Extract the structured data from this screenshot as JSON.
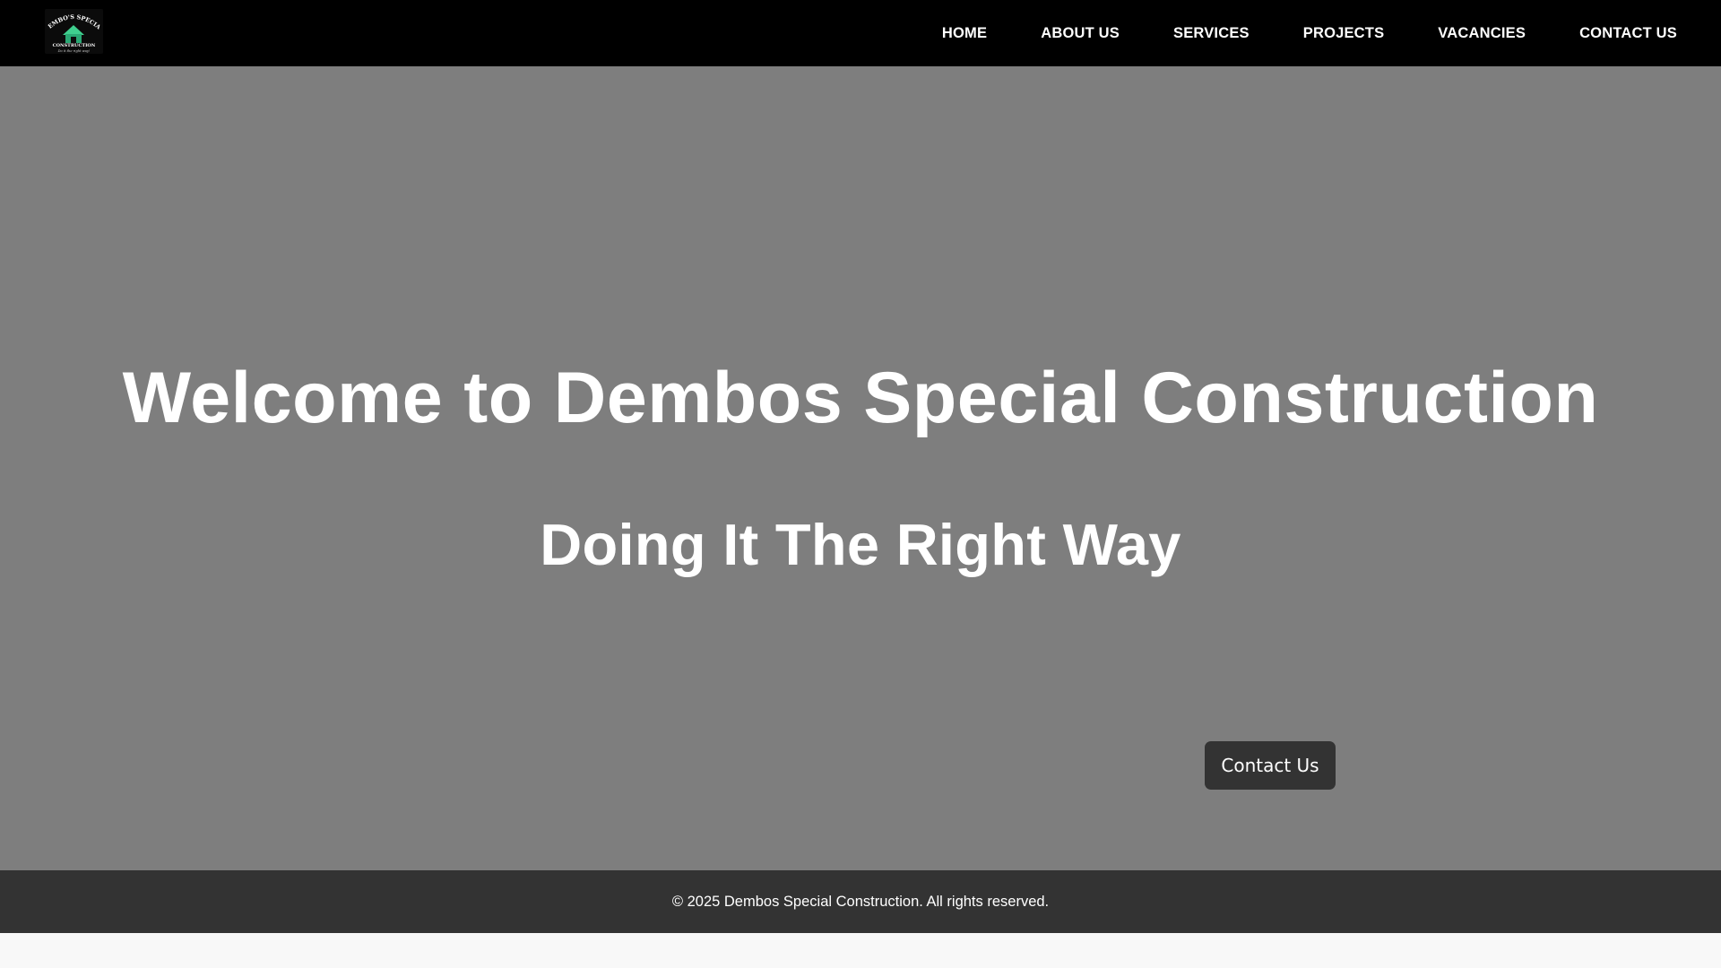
{
  "colors": {
    "nav_background": "#000000",
    "hero_background": "#7e7e7e",
    "footer_background": "#333333",
    "button_background": "#333333",
    "logo_accent": "#3fcf8e",
    "text": "#ffffff"
  },
  "header": {
    "logo": {
      "icon": "house-logo-icon",
      "top_text": "DEMBO'S SPECIAL",
      "bottom_text": "CONSTRUCTION",
      "tagline": "Do it the right way!"
    },
    "nav": [
      {
        "label": "HOME"
      },
      {
        "label": "ABOUT US"
      },
      {
        "label": "SERVICES"
      },
      {
        "label": "PROJECTS"
      },
      {
        "label": "VACANCIES"
      },
      {
        "label": "CONTACT US"
      }
    ]
  },
  "hero": {
    "title": "Welcome to Dembos Special Construction",
    "subtitle": "Doing It The Right Way",
    "cta_label": "Contact Us"
  },
  "footer": {
    "copyright": "© 2025 Dembos Special Construction. All rights reserved."
  }
}
